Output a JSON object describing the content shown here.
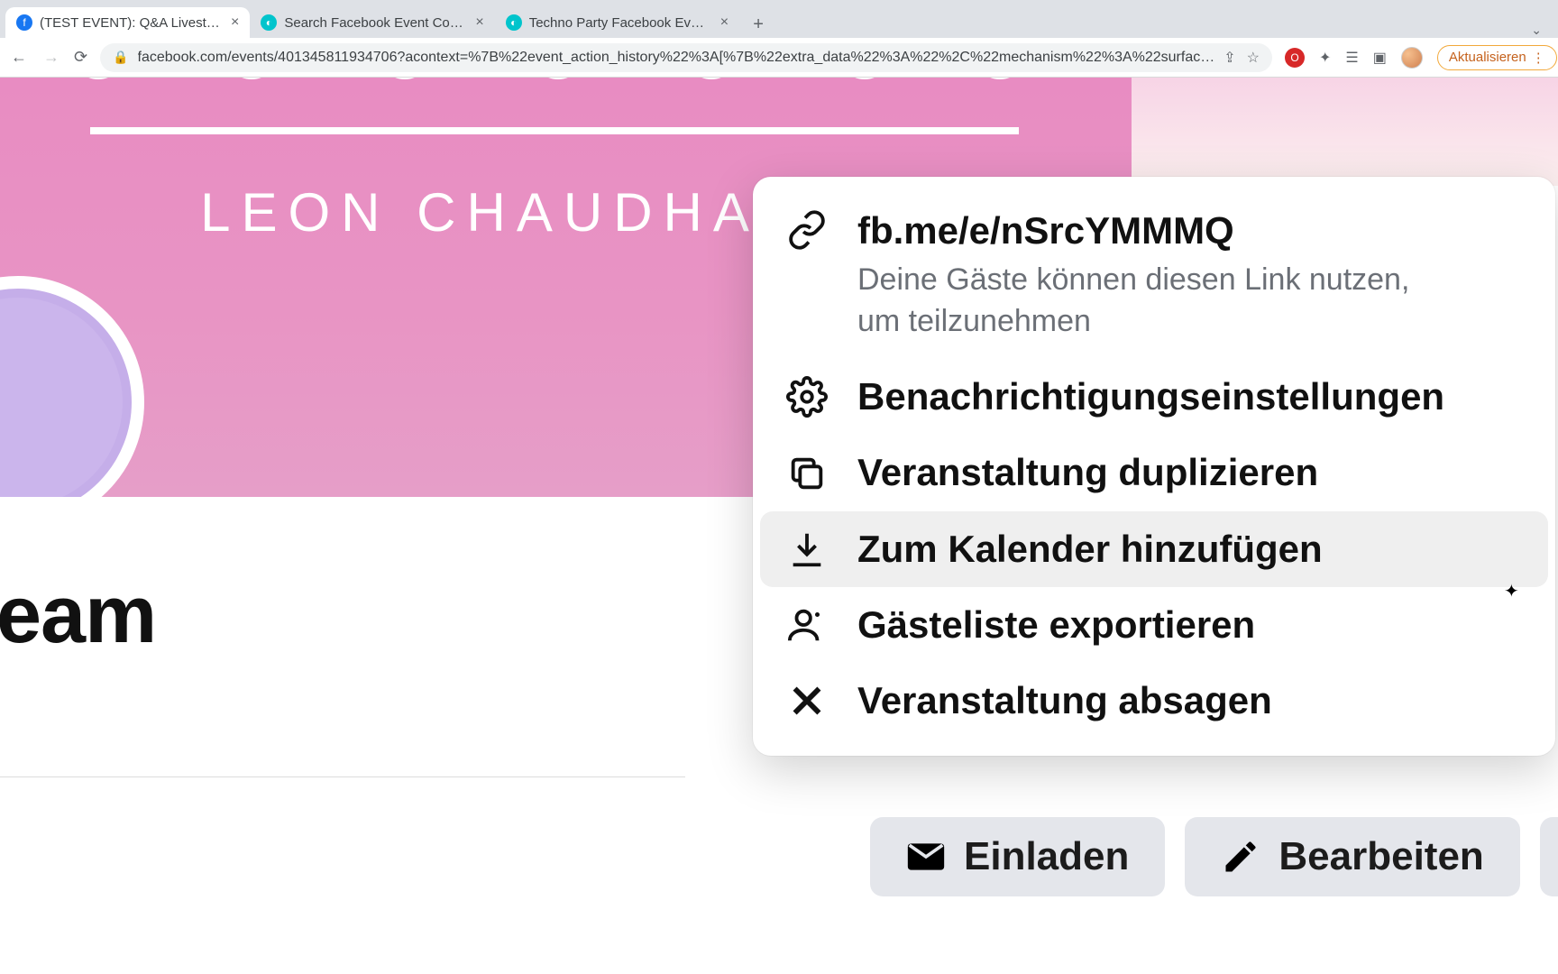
{
  "browser": {
    "tabs": [
      {
        "title": "(TEST EVENT): Q&A Livestream",
        "favicon": "fb"
      },
      {
        "title": "Search Facebook Event Cover",
        "favicon": "canva"
      },
      {
        "title": "Techno Party Facebook Event",
        "favicon": "canva"
      }
    ],
    "url": "facebook.com/events/401345811934706?acontext=%7B%22event_action_history%22%3A[%7B%22extra_data%22%3A%22%2C%22mechanism%22%3A%22surfac…",
    "update_label": "Aktualisieren"
  },
  "event": {
    "hero_name": "LEON CHAUDHA",
    "title_fragment": "eam",
    "invite_label": "Einladen",
    "edit_label": "Bearbeiten"
  },
  "popover": {
    "short_link": "fb.me/e/nSrcYMMMQ",
    "short_link_sub": "Deine Gäste können diesen Link nutzen, um teilzunehmen",
    "notifications": "Benachrichtigungseinstellungen",
    "duplicate": "Veranstaltung duplizieren",
    "calendar": "Zum Kalender hinzufügen",
    "export_guests": "Gästeliste exportieren",
    "cancel_event": "Veranstaltung absagen"
  }
}
